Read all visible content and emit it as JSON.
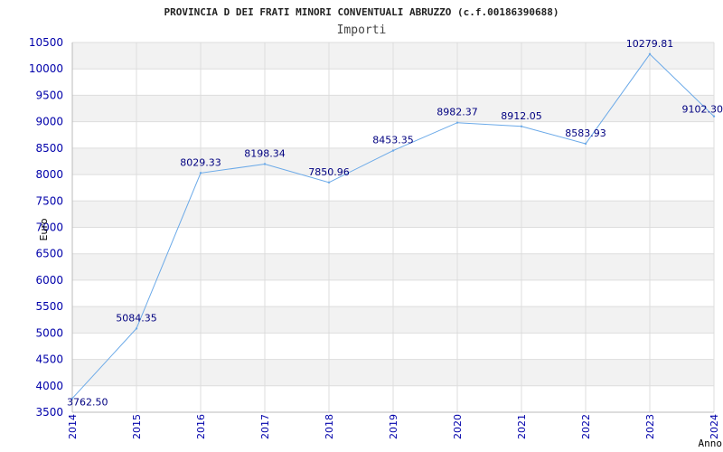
{
  "chart_data": {
    "type": "line",
    "title": "PROVINCIA D DEI FRATI MINORI CONVENTUALI ABRUZZO (c.f.00186390688)",
    "subtitle": "Importi",
    "xlabel": "Anno",
    "ylabel": "Euro",
    "x": [
      "2014",
      "2015",
      "2016",
      "2017",
      "2018",
      "2019",
      "2020",
      "2021",
      "2022",
      "2023",
      "2024"
    ],
    "series": [
      {
        "values": [
          3762.5,
          5084.35,
          8029.33,
          8198.34,
          7850.96,
          8453.35,
          8982.37,
          8912.05,
          8583.93,
          10279.81,
          9102.3
        ],
        "labels": [
          "3762.50",
          "5084.35",
          "8029.33",
          "8198.34",
          "7850.96",
          "8453.35",
          "8982.37",
          "8912.05",
          "8583.93",
          "10279.81",
          "9102.30"
        ]
      }
    ],
    "y_ticks": [
      3500,
      4000,
      4500,
      5000,
      5500,
      6000,
      6500,
      7000,
      7500,
      8000,
      8500,
      9000,
      9500,
      10000,
      10500
    ],
    "ylim": [
      3500,
      10500
    ],
    "grid": true,
    "legend": "none",
    "colors": {
      "line": "#6aa9e8",
      "tick_text": "#0000aa",
      "data_label": "#000080",
      "band": "#f2f2f2",
      "grid": "#dddddd",
      "title": "#222222"
    }
  }
}
